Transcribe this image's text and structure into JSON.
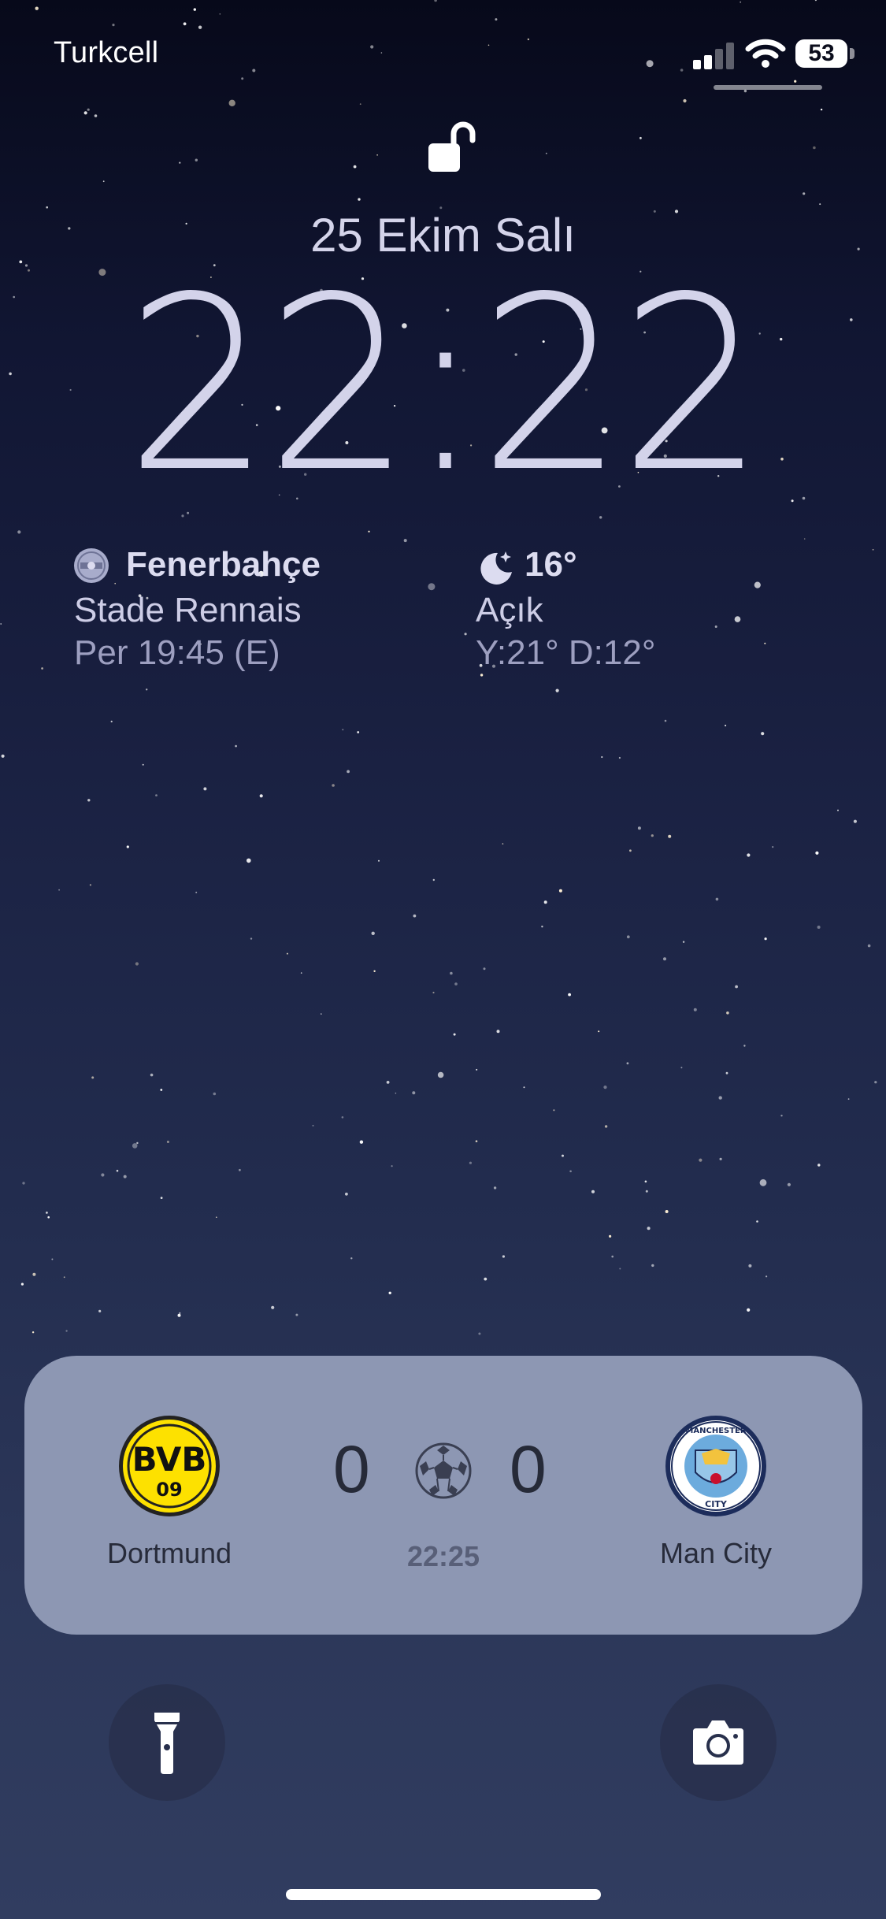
{
  "status_bar": {
    "carrier": "Turkcell",
    "battery_level": "53"
  },
  "lock_screen": {
    "date": "25 Ekim Salı",
    "time": "22:22"
  },
  "widgets": {
    "sports": {
      "team": "Fenerbahçe",
      "opponent": "Stade Rennais",
      "schedule": "Per 19:45 (E)"
    },
    "weather": {
      "temperature": "16°",
      "condition": "Açık",
      "high_low": "Y:21° D:12°"
    }
  },
  "live_activity": {
    "home_team": "Dortmund",
    "away_team": "Man City",
    "home_score": "0",
    "away_score": "0",
    "match_time": "22:25",
    "home_logo_text": "BVB 09",
    "away_logo_text": "MANCHESTER CITY"
  },
  "quick_actions": {
    "left_icon": "flashlight-icon",
    "right_icon": "camera-icon"
  },
  "colors": {
    "card_bg": "#8d97b3",
    "text_primary": "#d3d3ea",
    "bvb_yellow": "#fde100",
    "city_blue": "#6cabdd"
  }
}
